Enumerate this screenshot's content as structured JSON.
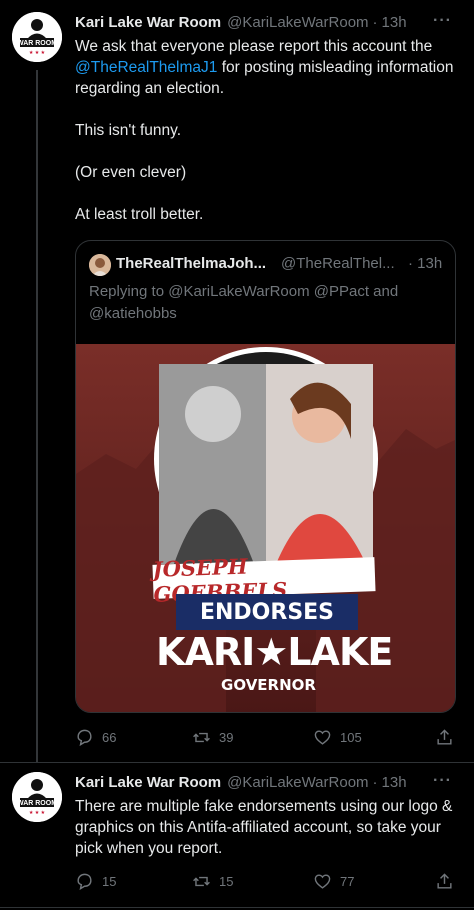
{
  "tweet1": {
    "display_name": "Kari Lake War Room",
    "handle": "@KariLakeWarRoom",
    "separator": "·",
    "time": "13h",
    "more": "···",
    "avatar_text": "WAR ROOM",
    "text_lines": [
      "We ask that everyone please report this account the",
      "@TheRealThelmaJ1",
      " for posting misleading information regarding an election.",
      "This isn't funny.",
      "(Or even clever)",
      "At least troll better."
    ],
    "quote": {
      "display_name": "TheRealThelmaJoh...",
      "handle": "@TheRealThel...",
      "separator": "·",
      "time": "13h",
      "reply_prefix": "Replying to ",
      "reply_mentions": "@KariLakeWarRoom @PPact and @katiehobbs",
      "image": {
        "line1": "JOSEPH GOEBBELS",
        "line2": "ENDORSES",
        "line3": "KARI★LAKE",
        "line4": "GOVERNOR",
        "accent_red": "#b8282a",
        "accent_navy": "#1a2d66",
        "bg": "#5a1f1d"
      }
    },
    "actions": {
      "replies": "66",
      "retweets": "39",
      "likes": "105"
    }
  },
  "tweet2": {
    "display_name": "Kari Lake War Room",
    "handle": "@KariLakeWarRoom",
    "separator": "·",
    "time": "13h",
    "more": "···",
    "avatar_text": "WAR ROOM",
    "text": "There are multiple fake endorsements using our logo & graphics on this Antifa-affiliated account, so take your pick when you report.",
    "actions": {
      "replies": "15",
      "retweets": "15",
      "likes": "77"
    }
  },
  "colors": {
    "link": "#1d9bf0",
    "muted": "#71767b",
    "text": "#e7e9ea",
    "bg": "#000000"
  }
}
